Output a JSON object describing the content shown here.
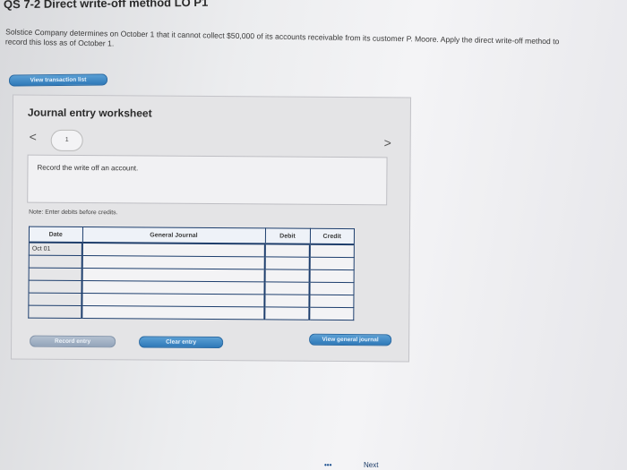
{
  "header": {
    "title": "QS 7-2 Direct write-off method LO P1"
  },
  "problem": {
    "text": "Solstice Company determines on October 1 that it cannot collect $50,000 of its accounts receivable from its customer P. Moore. Apply the direct write-off method to record this loss as of October 1."
  },
  "toolbar": {
    "view_transaction_label": "View transaction list"
  },
  "worksheet": {
    "title": "Journal entry worksheet",
    "prev_symbol": "<",
    "next_symbol": ">",
    "page_number": "1",
    "instruction": "Record the write off an account.",
    "note": "Note: Enter debits before credits.",
    "columns": {
      "date": "Date",
      "general_journal": "General Journal",
      "debit": "Debit",
      "credit": "Credit"
    },
    "rows": [
      {
        "date": "Oct 01",
        "account": "",
        "debit": "",
        "credit": ""
      },
      {
        "date": "",
        "account": "",
        "debit": "",
        "credit": ""
      },
      {
        "date": "",
        "account": "",
        "debit": "",
        "credit": ""
      },
      {
        "date": "",
        "account": "",
        "debit": "",
        "credit": ""
      },
      {
        "date": "",
        "account": "",
        "debit": "",
        "credit": ""
      },
      {
        "date": "",
        "account": "",
        "debit": "",
        "credit": ""
      }
    ],
    "record_entry_label": "Record entry",
    "clear_entry_label": "Clear entry",
    "view_general_journal_label": "View general journal"
  },
  "footer": {
    "dots": "•••",
    "next_label": "Next"
  },
  "colors": {
    "button_blue": "#2f79b8",
    "table_border": "#1e3f6e"
  }
}
